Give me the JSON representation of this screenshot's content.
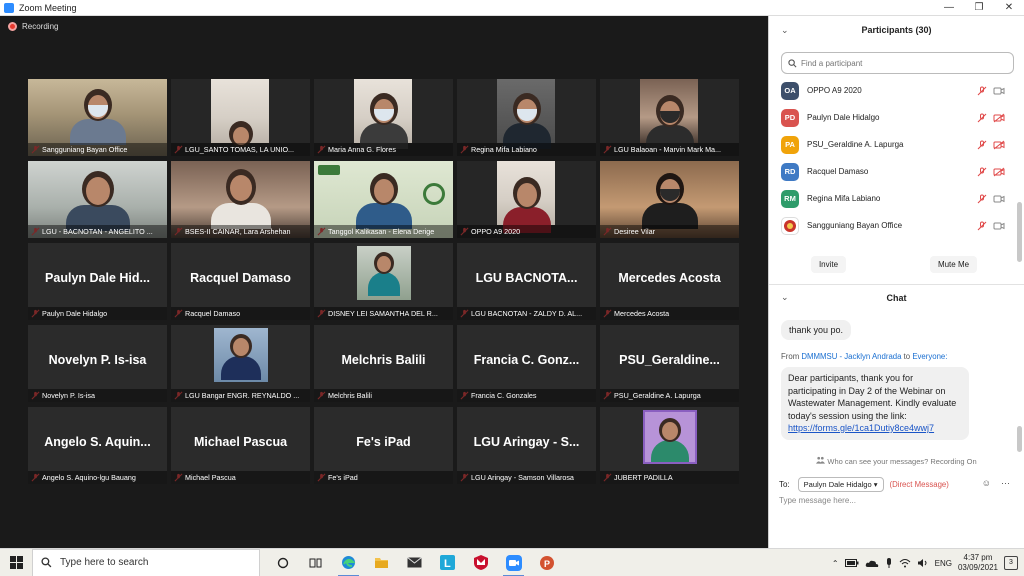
{
  "window": {
    "title": "Zoom Meeting",
    "controls": [
      "—",
      "❐",
      "✕"
    ]
  },
  "recording_label": "Recording",
  "tiles": [
    {
      "label": "Sangguniang Bayan Office",
      "kind": "video"
    },
    {
      "label": "LGU_SANTO TOMAS, LA UNIO...",
      "kind": "video"
    },
    {
      "label": "Maria Anna G. Flores",
      "kind": "video"
    },
    {
      "label": "Regina Mifa Labiano",
      "kind": "video"
    },
    {
      "label": "LGU Balaoan - Marvin Mark Ma...",
      "kind": "video"
    },
    {
      "label": "LGU - BACNOTAN - ANGELITO ...",
      "kind": "video"
    },
    {
      "label": "BSES-II CAINAR, Lara Arshehan",
      "kind": "video"
    },
    {
      "label": "Tanggol Kalikasan - Elena Derige",
      "kind": "video"
    },
    {
      "label": "OPPO A9 2020",
      "kind": "video"
    },
    {
      "label": "Desiree Vilar",
      "kind": "video"
    },
    {
      "label": "Paulyn Dale Hidalgo",
      "big": "Paulyn Dale Hid...",
      "kind": "name"
    },
    {
      "label": "Racquel Damaso",
      "big": "Racquel Damaso",
      "kind": "name"
    },
    {
      "label": "DISNEY LEI SAMANTHA DEL R...",
      "kind": "thumb"
    },
    {
      "label": "LGU BACNOTAN - ZALDY D. AL...",
      "big": "LGU BACNOTA...",
      "kind": "name"
    },
    {
      "label": "Mercedes Acosta",
      "big": "Mercedes Acosta",
      "kind": "name"
    },
    {
      "label": "Novelyn P. Is-isa",
      "big": "Novelyn P. Is-isa",
      "kind": "name"
    },
    {
      "label": "LGU Bangar ENGR. REYNALDO ...",
      "kind": "thumb"
    },
    {
      "label": "Melchris Balili",
      "big": "Melchris Balili",
      "kind": "name"
    },
    {
      "label": "Francia C. Gonzales",
      "big": "Francia C. Gonz...",
      "kind": "name"
    },
    {
      "label": "PSU_Geraldine A. Lapurga",
      "big": "PSU_Geraldine...",
      "kind": "name"
    },
    {
      "label": "Angelo S. Aquino-lgu Bauang",
      "big": "Angelo S. Aquin...",
      "kind": "name"
    },
    {
      "label": "Michael Pascua",
      "big": "Michael Pascua",
      "kind": "name"
    },
    {
      "label": "Fe's iPad",
      "big": "Fe's iPad",
      "kind": "name"
    },
    {
      "label": "LGU Aringay - Samson Villarosa",
      "big": "LGU Aringay - S...",
      "kind": "name"
    },
    {
      "label": "JUBERT PADILLA",
      "kind": "thumb"
    }
  ],
  "participants_panel": {
    "title": "Participants (30)",
    "search_placeholder": "Find a participant",
    "items": [
      {
        "initials": "OA",
        "name": "OPPO A9 2020",
        "color": "#3d4f6b",
        "video_off": false
      },
      {
        "initials": "PD",
        "name": "Paulyn Dale Hidalgo",
        "color": "#d9534f",
        "video_off": true
      },
      {
        "initials": "PA",
        "name": "PSU_Geraldine A. Lapurga",
        "color": "#f0a30a",
        "video_off": true
      },
      {
        "initials": "RD",
        "name": "Racquel Damaso",
        "color": "#3f7ac4",
        "video_off": true
      },
      {
        "initials": "RM",
        "name": "Regina Mifa Labiano",
        "color": "#2e9c6a",
        "video_off": false
      },
      {
        "initials": "",
        "name": "Sangguniang Bayan Office",
        "color": "#ffffff",
        "video_off": false
      }
    ],
    "invite_label": "Invite",
    "mute_me_label": "Mute Me"
  },
  "chat": {
    "title": "Chat",
    "message1": "thank you po.",
    "from_prefix": "From",
    "from_sender": "DMMMSU - Jacklyn Andrada",
    "from_to": "to",
    "from_recipient": "Everyone:",
    "message2_text": "Dear participants, thank you for participating in Day 2 of the Webinar on Wastewater Management. Kindly evaluate today's session using the link:",
    "message2_link": "https://forms.gle/1ca1Dutiy8ce4wwj7",
    "who_can_see": "Who can see your messages? Recording On",
    "to_label": "To:",
    "to_value": "Paulyn Dale Hidalgo",
    "direct_label": "(Direct Message)",
    "input_placeholder": "Type message here..."
  },
  "taskbar": {
    "search_placeholder": "Type here to search",
    "language": "ENG",
    "time": "4:37 pm",
    "date": "03/09/2021",
    "notification_count": "3"
  }
}
